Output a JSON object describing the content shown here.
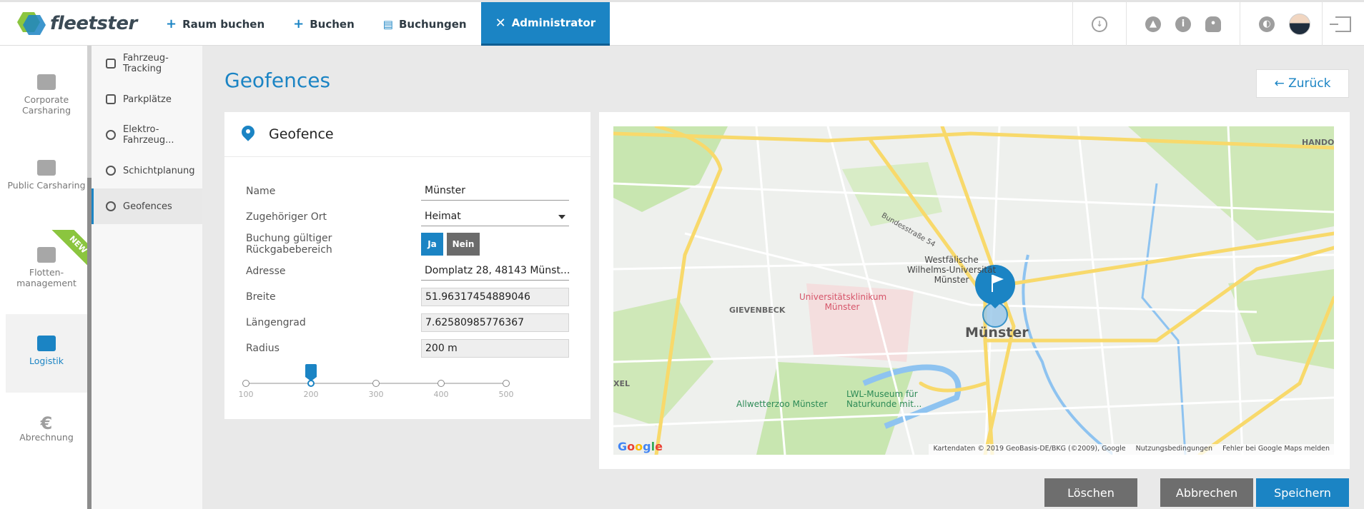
{
  "brand": {
    "name": "fleetster"
  },
  "topnav": {
    "items": [
      {
        "label": "Raum buchen",
        "icon": "plus-icon"
      },
      {
        "label": "Buchen",
        "icon": "plus-icon"
      },
      {
        "label": "Buchungen",
        "icon": "clipboard-icon"
      },
      {
        "label": "Administrator",
        "icon": "tools-icon"
      }
    ]
  },
  "leftnav": {
    "items": [
      {
        "label": "Corporate Carsharing",
        "icon": "building-icon"
      },
      {
        "label": "Public Carsharing",
        "icon": "public-icon"
      },
      {
        "label": "Flotten-management",
        "icon": "car-icon",
        "badge": "NEW"
      },
      {
        "label": "Logistik",
        "icon": "map-icon"
      },
      {
        "label": "Abrechnung",
        "icon": "euro-icon",
        "glyph": "€"
      }
    ]
  },
  "subnav": {
    "items": [
      {
        "label": "Fahrzeug-Tracking"
      },
      {
        "label": "Parkplätze"
      },
      {
        "label": "Elektro-Fahrzeug..."
      },
      {
        "label": "Schichtplanung"
      },
      {
        "label": "Geofences"
      }
    ]
  },
  "page": {
    "title": "Geofences",
    "back_label": "← Zurück"
  },
  "form": {
    "title": "Geofence",
    "name_label": "Name",
    "name_value": "Münster",
    "ort_label": "Zugehöriger Ort",
    "ort_value": "Heimat",
    "rueckgabe_label": "Buchung gültiger Rückgabebereich",
    "ja_label": "Ja",
    "nein_label": "Nein",
    "adresse_label": "Adresse",
    "adresse_value": "Domplatz 28, 48143 Münst...",
    "breite_label": "Breite",
    "breite_value": "51.96317454889046",
    "laenge_label": "Längengrad",
    "laenge_value": "7.62580985776367",
    "radius_label": "Radius",
    "radius_value": "200 m"
  },
  "slider": {
    "ticks": [
      "100",
      "200",
      "300",
      "400",
      "500"
    ],
    "min": 100,
    "max": 500,
    "value": 200
  },
  "map": {
    "labels": {
      "gievenbeck": "GIEVENBECK",
      "klinik": "Universitätsklinikum Münster",
      "uni": "Westfälische Wilhelms-Universität Münster",
      "muenster": "Münster",
      "allwetterzoo": "Allwetterzoo Münster",
      "lwl": "LWL-Museum für Naturkunde mit...",
      "handorf": "HANDOF",
      "xel": "XEL",
      "bundesstrasse": "Bundesstraße 54"
    },
    "attribution": [
      "Kartendaten © 2019 GeoBasis-DE/BKG (©2009), Google",
      "Nutzungsbedingungen",
      "Fehler bei Google Maps melden"
    ],
    "colors": {
      "water": "#8ec3f0",
      "park": "#c8e6b0",
      "road_major": "#f8d96b",
      "marker": "#1b84c4"
    }
  },
  "actions": {
    "delete_label": "Löschen",
    "cancel_label": "Abbrechen",
    "save_label": "Speichern"
  }
}
